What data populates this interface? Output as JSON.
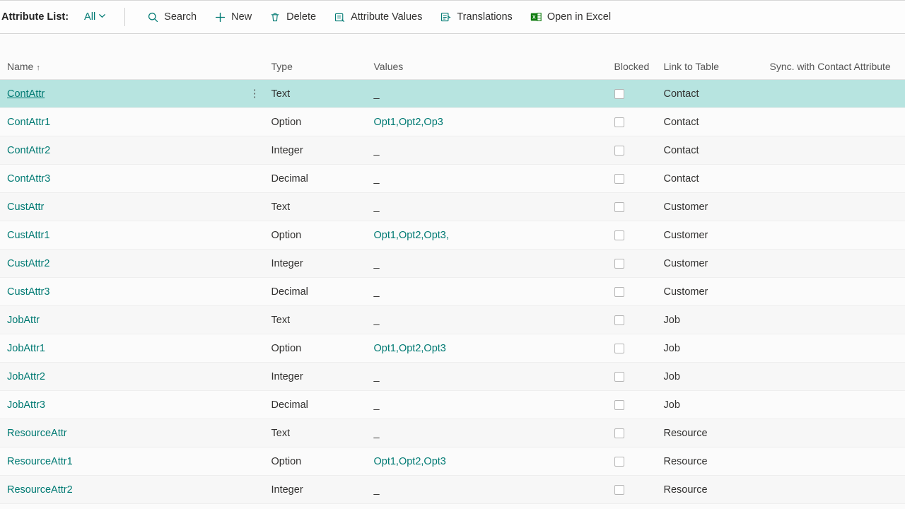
{
  "toolbar": {
    "title": "Attribute List:",
    "filter": "All",
    "search": "Search",
    "new": "New",
    "delete": "Delete",
    "attrValues": "Attribute Values",
    "translations": "Translations",
    "openExcel": "Open in Excel"
  },
  "columns": {
    "name": "Name",
    "type": "Type",
    "values": "Values",
    "blocked": "Blocked",
    "linkToTable": "Link to Table",
    "sync": "Sync. with Contact Attribute"
  },
  "rows": [
    {
      "name": "ContAttr",
      "type": "Text",
      "values": "_",
      "blocked": false,
      "link": "Contact",
      "selected": true
    },
    {
      "name": "ContAttr1",
      "type": "Option",
      "values": "Opt1,Opt2,Op3",
      "blocked": false,
      "link": "Contact"
    },
    {
      "name": "ContAttr2",
      "type": "Integer",
      "values": "_",
      "blocked": false,
      "link": "Contact"
    },
    {
      "name": "ContAttr3",
      "type": "Decimal",
      "values": "_",
      "blocked": false,
      "link": "Contact"
    },
    {
      "name": "CustAttr",
      "type": "Text",
      "values": "_",
      "blocked": false,
      "link": "Customer"
    },
    {
      "name": "CustAttr1",
      "type": "Option",
      "values": "Opt1,Opt2,Opt3,",
      "blocked": false,
      "link": "Customer"
    },
    {
      "name": "CustAttr2",
      "type": "Integer",
      "values": "_",
      "blocked": false,
      "link": "Customer"
    },
    {
      "name": "CustAttr3",
      "type": "Decimal",
      "values": "_",
      "blocked": false,
      "link": "Customer"
    },
    {
      "name": "JobAttr",
      "type": "Text",
      "values": "_",
      "blocked": false,
      "link": "Job"
    },
    {
      "name": "JobAttr1",
      "type": "Option",
      "values": "Opt1,Opt2,Opt3",
      "blocked": false,
      "link": "Job"
    },
    {
      "name": "JobAttr2",
      "type": "Integer",
      "values": "_",
      "blocked": false,
      "link": "Job"
    },
    {
      "name": "JobAttr3",
      "type": "Decimal",
      "values": "_",
      "blocked": false,
      "link": "Job"
    },
    {
      "name": "ResourceAttr",
      "type": "Text",
      "values": "_",
      "blocked": false,
      "link": "Resource"
    },
    {
      "name": "ResourceAttr1",
      "type": "Option",
      "values": "Opt1,Opt2,Opt3",
      "blocked": false,
      "link": "Resource"
    },
    {
      "name": "ResourceAttr2",
      "type": "Integer",
      "values": "_",
      "blocked": false,
      "link": "Resource"
    }
  ]
}
